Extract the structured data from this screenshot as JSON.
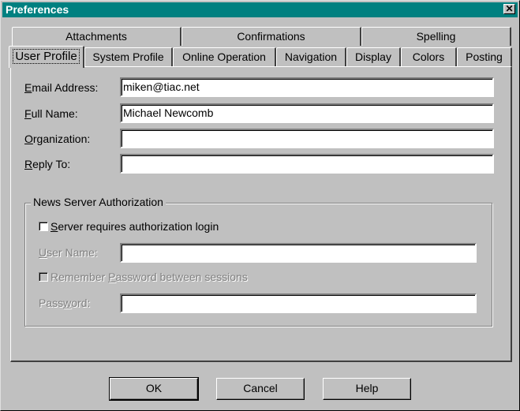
{
  "window": {
    "title": "Preferences",
    "close_glyph": "✕"
  },
  "tabs_row1": [
    {
      "label": "Attachments"
    },
    {
      "label": "Confirmations"
    },
    {
      "label": "Spelling"
    }
  ],
  "tabs_row2": [
    {
      "label": "User Profile",
      "active": true
    },
    {
      "label": "System Profile"
    },
    {
      "label": "Online Operation"
    },
    {
      "label": "Navigation"
    },
    {
      "label": "Display"
    },
    {
      "label": "Colors"
    },
    {
      "label": "Posting"
    }
  ],
  "profile": {
    "email_label_u": "E",
    "email_label_rest": "mail Address:",
    "email_value": "miken@tiac.net",
    "fullname_label_u": "F",
    "fullname_label_rest": "ull Name:",
    "fullname_value": "Michael Newcomb",
    "org_label_u": "O",
    "org_label_rest": "rganization:",
    "org_value": "",
    "replyto_label_u": "R",
    "replyto_label_rest": "eply To:",
    "replyto_value": ""
  },
  "auth": {
    "group_title": "News Server Authorization",
    "requires_login_u": "S",
    "requires_login_rest": "erver requires authorization login",
    "requires_login_checked": false,
    "username_label_u": "U",
    "username_label_rest": "ser Name:",
    "username_value": "",
    "remember_pre": "Remember ",
    "remember_u": "P",
    "remember_rest": "assword between sessions",
    "remember_checked": false,
    "password_pre": "Pass",
    "password_u": "w",
    "password_rest": "ord:",
    "password_value": ""
  },
  "buttons": {
    "ok": "OK",
    "cancel": "Cancel",
    "help": "Help"
  },
  "colors": {
    "titlebar": "#008080",
    "face": "#c0c0c0"
  },
  "icons": {
    "close": "close-icon"
  }
}
